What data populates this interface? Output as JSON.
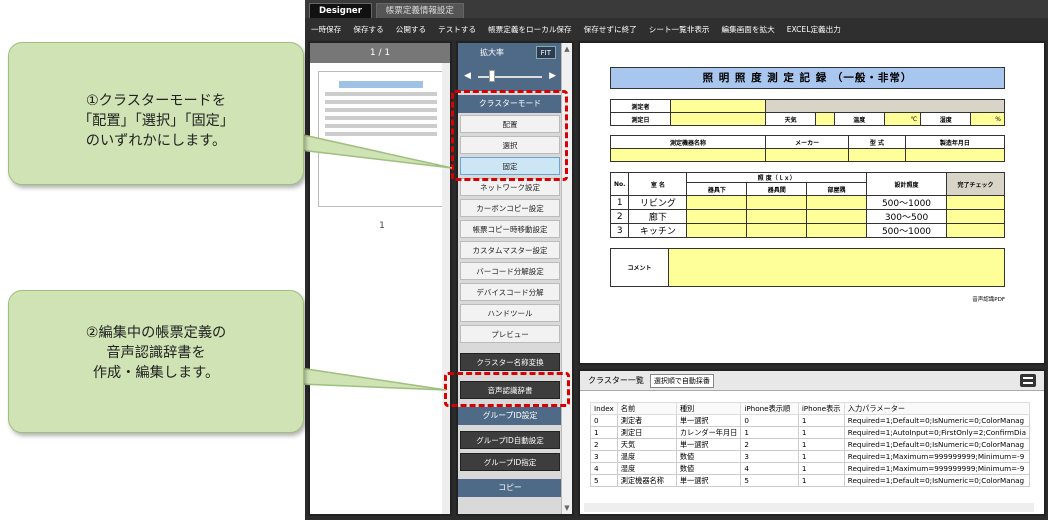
{
  "tabs": [
    "Designer",
    "帳票定義情報設定"
  ],
  "menu": [
    "一時保存",
    "保存する",
    "公開する",
    "テストする",
    "帳票定義をローカル保存",
    "保存せずに終了",
    "シート一覧非表示",
    "編集画面を拡大",
    "EXCEL定義出力"
  ],
  "thumb": {
    "pager": "1 / 1",
    "page_no": "1"
  },
  "side": {
    "zoom_label": "拡大率",
    "fit": "FIT",
    "cluster_mode": "クラスターモード",
    "mode_buttons": [
      "配置",
      "選択",
      "固定"
    ],
    "tools": [
      "ネットワーク設定",
      "カーボンコピー設定",
      "帳票コピー時移動設定",
      "カスタムマスター設定",
      "バーコード分解設定",
      "デバイスコード分解",
      "ハンドツール",
      "プレビュー"
    ],
    "dark_buttons": [
      "クラスター名称変換",
      "音声認識辞書",
      "グループID自動設定",
      "グループID指定"
    ],
    "group_id": "グループID設定",
    "copy": "コピー"
  },
  "form": {
    "title": "照 明 照 度 測 定 記 録 （一般・非常）",
    "measurer": "測定者",
    "date": "測定日",
    "weather": "天気",
    "temp": "温度",
    "celsius": "℃",
    "humidity": "湿度",
    "percent": "%",
    "device_name": "測定機器名称",
    "maker": "メーカー",
    "model": "型 式",
    "mfg_date": "製造年月日",
    "no": "No.",
    "room": "室 名",
    "lux": "照 度（ｌｘ）",
    "col_floor": "器具下",
    "col_between": "器具間",
    "col_corner": "部屋隅",
    "design": "設計照度",
    "check": "完了チェック",
    "rows": [
      {
        "no": "1",
        "room": "リビング",
        "design": "500～1000"
      },
      {
        "no": "2",
        "room": "廊下",
        "design": "300～500"
      },
      {
        "no": "3",
        "room": "キッチン",
        "design": "500～1000"
      }
    ],
    "comment": "コメント",
    "footer": "音声認識PDF"
  },
  "cluster_list": {
    "title": "クラスター一覧",
    "auto": "選択順で自動採番",
    "headers": [
      "Index",
      "名前",
      "種別",
      "iPhone表示順",
      "iPhone表示",
      "入力パラメーター"
    ],
    "rows": [
      [
        "0",
        "測定者",
        "単一選択",
        "0",
        "1",
        "Required=1;Default=0;IsNumeric=0;ColorManag"
      ],
      [
        "1",
        "測定日",
        "カレンダー年月日",
        "1",
        "1",
        "Required=1;AutoInput=0;FirstOnly=2;ConfirmDia"
      ],
      [
        "2",
        "天気",
        "単一選択",
        "2",
        "1",
        "Required=1;Default=0;IsNumeric=0;ColorManag"
      ],
      [
        "3",
        "温度",
        "数値",
        "3",
        "1",
        "Required=1;Maximum=999999999;Minimum=-9"
      ],
      [
        "4",
        "湿度",
        "数値",
        "4",
        "1",
        "Required=1;Maximum=999999999;Minimum=-9"
      ],
      [
        "5",
        "測定機器名称",
        "単一選択",
        "5",
        "1",
        "Required=1;Default=0;IsNumeric=0;ColorManag"
      ]
    ]
  },
  "callouts": {
    "one": [
      "①クラスターモードを",
      "「配置」「選択」「固定」",
      "のいずれかにします。"
    ],
    "two": [
      "②編集中の帳票定義の",
      "音声認識辞書を",
      "作成・編集します。"
    ]
  }
}
